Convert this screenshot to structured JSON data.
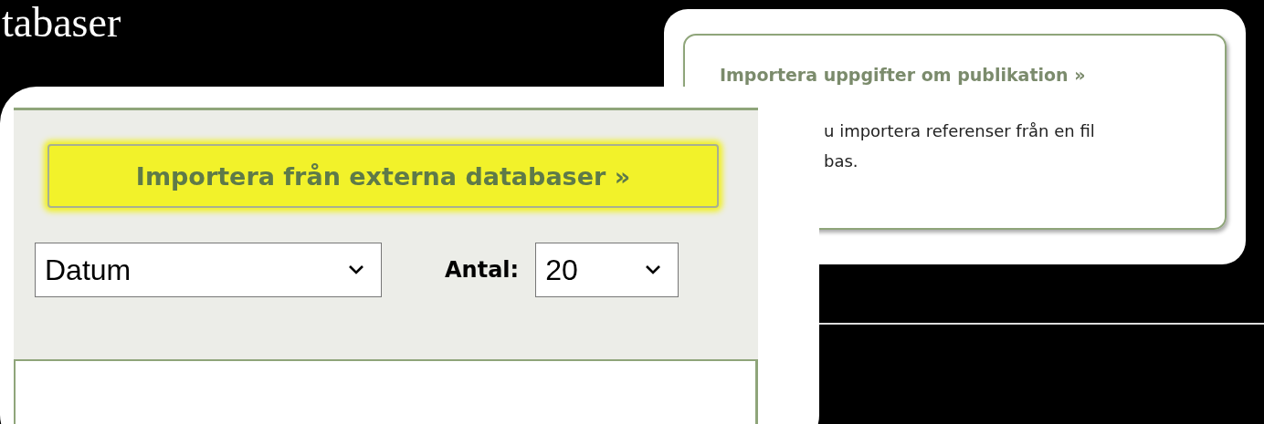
{
  "slide_title": "tabaser",
  "back_screenshot": {
    "link": "Importera uppgifter om publikation »",
    "text_lines": [
      "u importera referenser från en fil",
      "bas."
    ]
  },
  "front_screenshot": {
    "import_button": {
      "label": "Importera från externa databaser »",
      "highlighted": true
    },
    "sort_select": {
      "value": "Datum"
    },
    "count_label": "Antal:",
    "count_select": {
      "value": "20"
    }
  }
}
